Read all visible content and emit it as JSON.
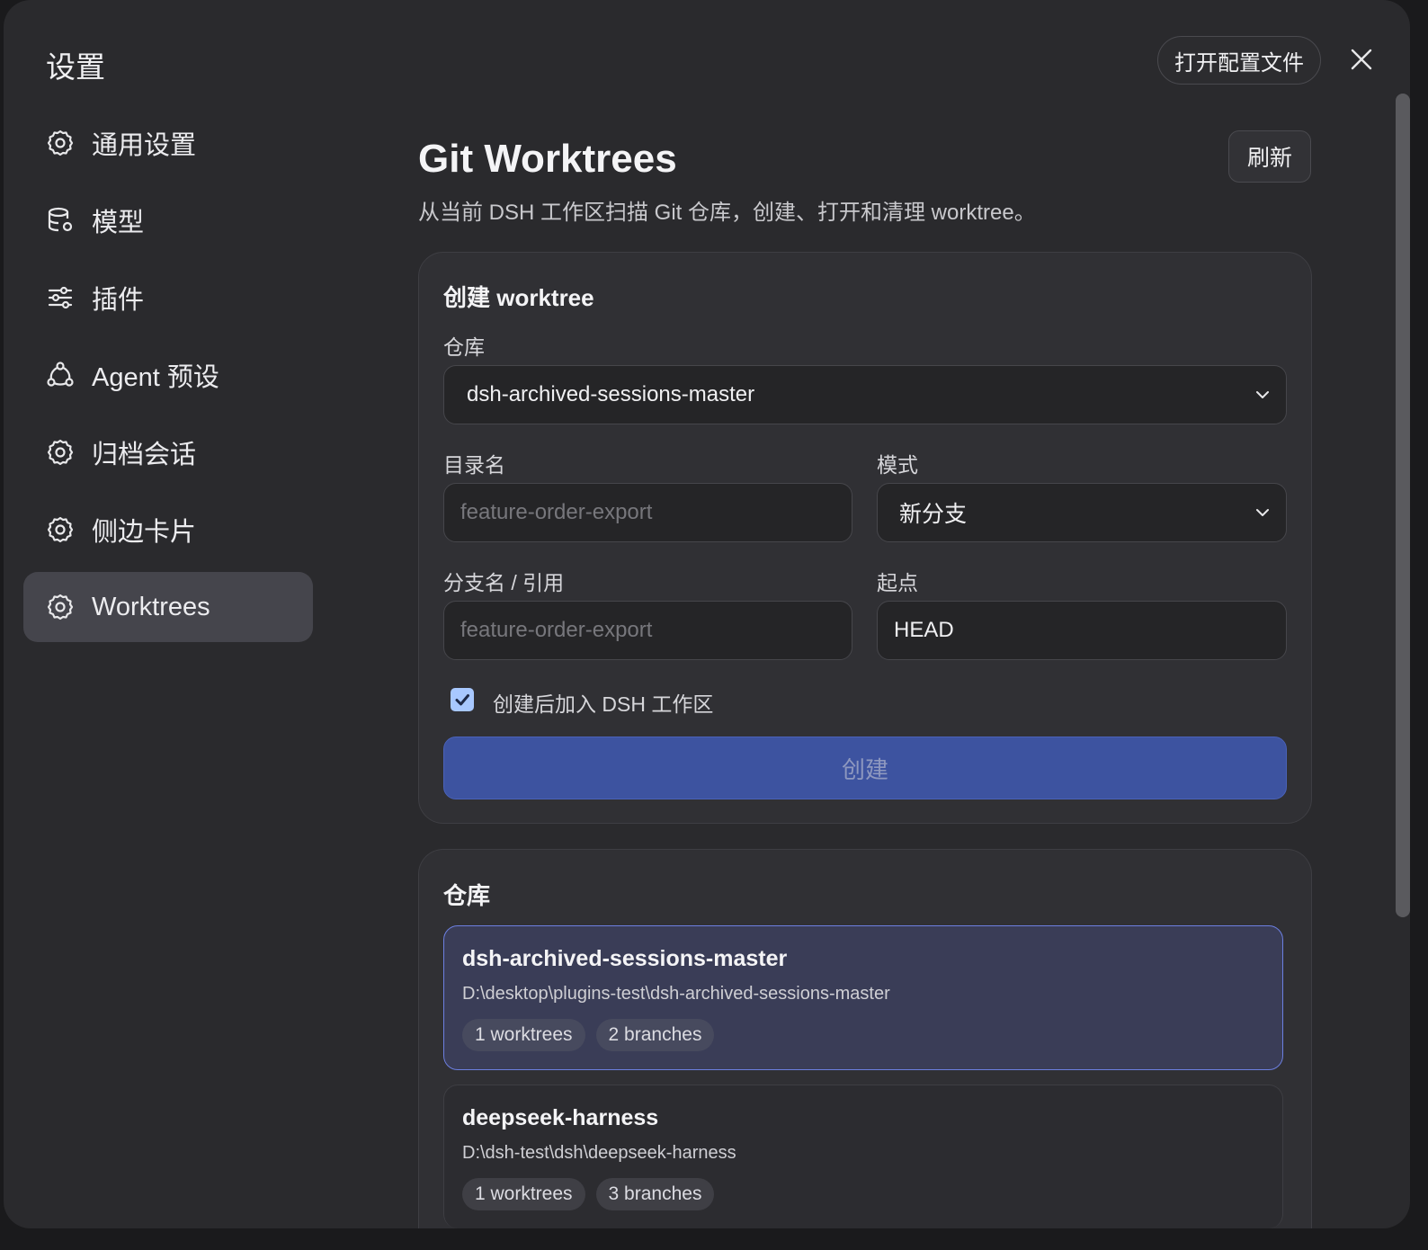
{
  "window": {
    "title": "设置",
    "open_config_label": "打开配置文件"
  },
  "sidebar": {
    "items": [
      {
        "label": "通用设置",
        "icon": "gear-icon"
      },
      {
        "label": "模型",
        "icon": "database-gear-icon"
      },
      {
        "label": "插件",
        "icon": "sliders-icon"
      },
      {
        "label": "Agent 预设",
        "icon": "agent-network-icon"
      },
      {
        "label": "归档会话",
        "icon": "gear-icon"
      },
      {
        "label": "侧边卡片",
        "icon": "gear-icon"
      },
      {
        "label": "Worktrees",
        "icon": "gear-icon",
        "active": true
      }
    ]
  },
  "main": {
    "title": "Git Worktrees",
    "refresh_label": "刷新",
    "subtitle": "从当前 DSH 工作区扫描 Git 仓库，创建、打开和清理 worktree。",
    "create": {
      "heading": "创建 worktree",
      "repo_label": "仓库",
      "repo_value": "dsh-archived-sessions-master",
      "dir_label": "目录名",
      "dir_placeholder": "feature-order-export",
      "mode_label": "模式",
      "mode_value": "新分支",
      "branch_label": "分支名 / 引用",
      "branch_placeholder": "feature-order-export",
      "start_label": "起点",
      "start_value": "HEAD",
      "add_to_workspace_label": "创建后加入 DSH 工作区",
      "add_to_workspace_checked": true,
      "create_label": "创建"
    },
    "repos": {
      "heading": "仓库",
      "items": [
        {
          "name": "dsh-archived-sessions-master",
          "path": "D:\\desktop\\plugins-test\\dsh-archived-sessions-master",
          "worktrees": "1 worktrees",
          "branches": "2 branches",
          "selected": true
        },
        {
          "name": "deepseek-harness",
          "path": "D:\\dsh-test\\dsh\\deepseek-harness",
          "worktrees": "1 worktrees",
          "branches": "3 branches",
          "selected": false
        }
      ]
    }
  },
  "colors": {
    "accent": "#3d53a0",
    "selected_border": "#6c7fe0",
    "checkbox": "#a8c8ff"
  }
}
